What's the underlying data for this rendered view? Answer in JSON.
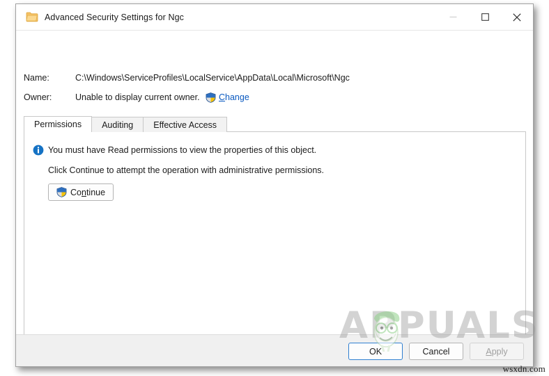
{
  "window": {
    "title": "Advanced Security Settings for Ngc",
    "icon": "folder-icon",
    "caption": {
      "minimize": "—",
      "maximize": "□",
      "close": "✕"
    }
  },
  "fields": {
    "name_label": "Name:",
    "name_value": "C:\\Windows\\ServiceProfiles\\LocalService\\AppData\\Local\\Microsoft\\Ngc",
    "owner_label": "Owner:",
    "owner_value": "Unable to display current owner.",
    "change_link": "Change",
    "change_link_accel": "C",
    "change_link_rest": "hange"
  },
  "tabs": [
    {
      "label": "Permissions",
      "selected": true
    },
    {
      "label": "Auditing",
      "selected": false
    },
    {
      "label": "Effective Access",
      "selected": false
    }
  ],
  "panel": {
    "info_icon": "information-icon",
    "info_text": "You must have Read permissions to view the properties of this object.",
    "hint_text": "Click Continue to attempt the operation with administrative permissions.",
    "continue_button": {
      "prefix": "Co",
      "accel": "n",
      "suffix": "tinue",
      "label": "Continue",
      "icon": "uac-shield-icon"
    }
  },
  "footer": {
    "ok": "OK",
    "cancel": "Cancel",
    "apply": {
      "prefix": "",
      "accel": "A",
      "suffix": "pply",
      "label": "Apply",
      "disabled": true
    }
  },
  "watermark": {
    "text": "APPUALS",
    "source": "wsxdn.com"
  },
  "colors": {
    "accent": "#0a59c0",
    "info_blue": "#1572c4",
    "shield_blue": "#2d6fc0",
    "shield_yellow": "#f5c20a",
    "default_button_border": "#2f7fd1",
    "window_border": "#a0a0a0",
    "footer_bg": "#f0f0f0"
  }
}
